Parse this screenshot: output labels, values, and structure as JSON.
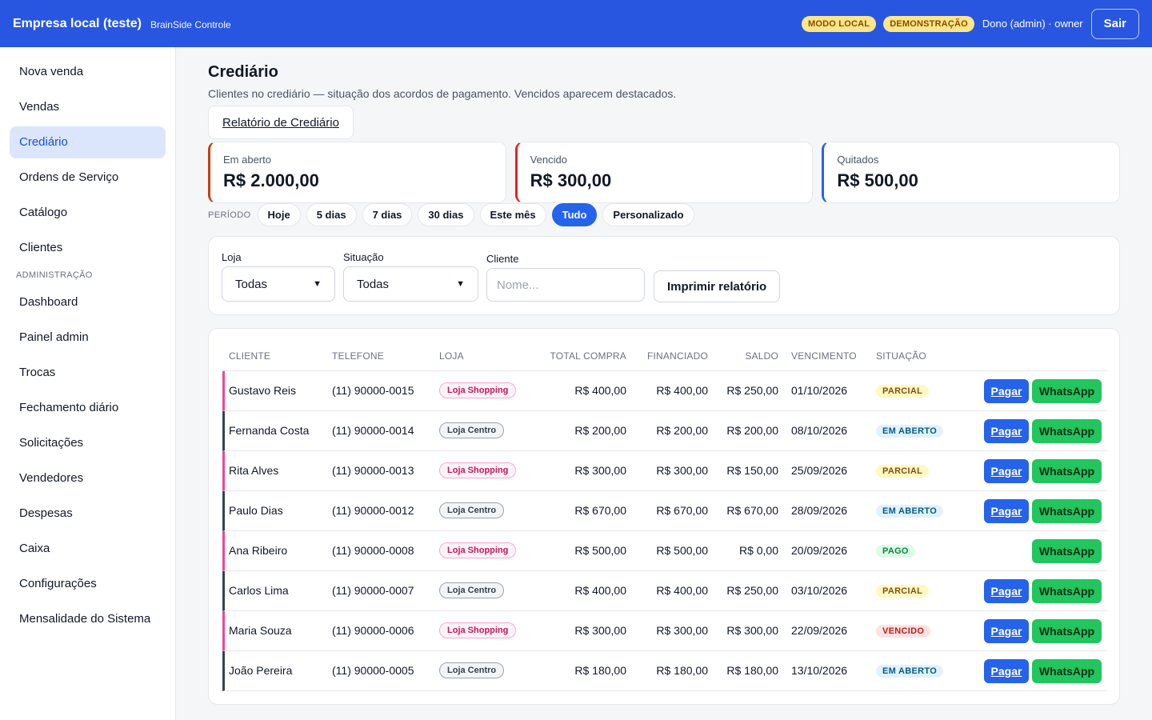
{
  "app": {
    "name": "Empresa local (teste)",
    "subtitle": "BrainSide Controle",
    "badges": [
      "MODO LOCAL",
      "DEMONSTRAÇÃO"
    ],
    "user": "Dono (admin) · owner",
    "logout_label": "Sair"
  },
  "sidebar": {
    "items": [
      "Nova venda",
      "Vendas",
      "Crediário",
      "Ordens de Serviço",
      "Catálogo",
      "Clientes"
    ],
    "active": "Crediário",
    "admin_section": "ADMINISTRAÇÃO",
    "admin_items": [
      "Dashboard",
      "Painel admin",
      "Trocas",
      "Fechamento diário",
      "Solicitações",
      "Vendedores",
      "Despesas",
      "Caixa",
      "Configurações",
      "Mensalidade do Sistema"
    ]
  },
  "page": {
    "title": "Crediário",
    "subtitle": "Clientes no crediário — situação dos acordos de pagamento. Vencidos aparecem destacados.",
    "report_button": "Relatório de Crediário"
  },
  "summary": [
    {
      "label": "Em aberto",
      "value": "R$ 2.000,00",
      "color": "#c2410c"
    },
    {
      "label": "Vencido",
      "value": "R$ 300,00",
      "color": "#dc2626"
    },
    {
      "label": "Quitados",
      "value": "R$ 500,00",
      "color": "#2563eb"
    }
  ],
  "period": {
    "label": "PERÍODO",
    "options": [
      "Hoje",
      "5 dias",
      "7 dias",
      "30 dias",
      "Este mês",
      "Tudo",
      "Personalizado"
    ],
    "selected": "Tudo"
  },
  "filters": {
    "store_label": "Loja",
    "store_value": "Todas",
    "status_label": "Situação",
    "status_value": "Todas",
    "client_label": "Cliente",
    "client_placeholder": "Nome...",
    "print_button": "Imprimir relatório"
  },
  "table": {
    "headers": [
      "CLIENTE",
      "TELEFONE",
      "LOJA",
      "TOTAL COMPRA",
      "FINANCIADO",
      "SALDO",
      "VENCIMENTO",
      "SITUAÇÃO"
    ],
    "pay_label": "Pagar",
    "whatsapp_label": "WhatsApp",
    "rows": [
      {
        "client": "Gustavo Reis",
        "phone": "(11) 90000-0015",
        "store": "Loja Shopping",
        "total": "R$ 400,00",
        "financed": "R$ 400,00",
        "balance": "R$ 250,00",
        "due": "01/10/2026",
        "status": "PARCIAL",
        "can_pay": true
      },
      {
        "client": "Fernanda Costa",
        "phone": "(11) 90000-0014",
        "store": "Loja Centro",
        "total": "R$ 200,00",
        "financed": "R$ 200,00",
        "balance": "R$ 200,00",
        "due": "08/10/2026",
        "status": "EM ABERTO",
        "can_pay": true
      },
      {
        "client": "Rita Alves",
        "phone": "(11) 90000-0013",
        "store": "Loja Shopping",
        "total": "R$ 300,00",
        "financed": "R$ 300,00",
        "balance": "R$ 150,00",
        "due": "25/09/2026",
        "status": "PARCIAL",
        "can_pay": true
      },
      {
        "client": "Paulo Dias",
        "phone": "(11) 90000-0012",
        "store": "Loja Centro",
        "total": "R$ 670,00",
        "financed": "R$ 670,00",
        "balance": "R$ 670,00",
        "due": "28/09/2026",
        "status": "EM ABERTO",
        "can_pay": true
      },
      {
        "client": "Ana Ribeiro",
        "phone": "(11) 90000-0008",
        "store": "Loja Shopping",
        "total": "R$ 500,00",
        "financed": "R$ 500,00",
        "balance": "R$ 0,00",
        "due": "20/09/2026",
        "status": "PAGO",
        "can_pay": false
      },
      {
        "client": "Carlos Lima",
        "phone": "(11) 90000-0007",
        "store": "Loja Centro",
        "total": "R$ 400,00",
        "financed": "R$ 400,00",
        "balance": "R$ 250,00",
        "due": "03/10/2026",
        "status": "PARCIAL",
        "can_pay": true
      },
      {
        "client": "Maria Souza",
        "phone": "(11) 90000-0006",
        "store": "Loja Shopping",
        "total": "R$ 300,00",
        "financed": "R$ 300,00",
        "balance": "R$ 300,00",
        "due": "22/09/2026",
        "status": "VENCIDO",
        "can_pay": true
      },
      {
        "client": "João Pereira",
        "phone": "(11) 90000-0005",
        "store": "Loja Centro",
        "total": "R$ 180,00",
        "financed": "R$ 180,00",
        "balance": "R$ 180,00",
        "due": "13/10/2026",
        "status": "EM ABERTO",
        "can_pay": true
      }
    ]
  },
  "colors": {
    "primary": "#2856e0",
    "shopping_accent": "#ec4899",
    "centro_accent": "#374151",
    "status": {
      "PARCIAL": {
        "bg": "#fef9c3",
        "fg": "#854d0e"
      },
      "EM ABERTO": {
        "bg": "#e0f2fe",
        "fg": "#075985"
      },
      "PAGO": {
        "bg": "#dcfce7",
        "fg": "#15803d"
      },
      "VENCIDO": {
        "bg": "#fee2e2",
        "fg": "#b91c1c"
      }
    }
  }
}
